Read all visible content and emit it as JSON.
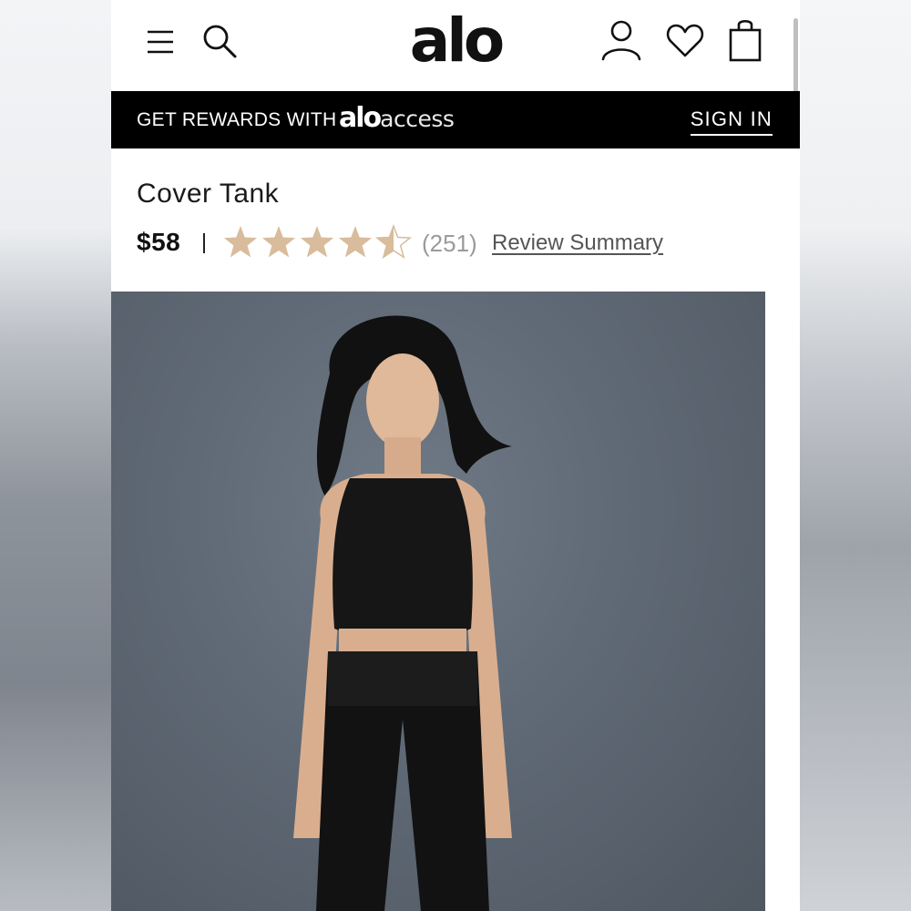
{
  "header": {
    "logo_text": "alo",
    "icons": [
      "menu-icon",
      "search-icon",
      "account-icon",
      "heart-icon",
      "bag-icon"
    ]
  },
  "rewards_bar": {
    "text": "GET REWARDS WITH",
    "brand_alo": "alo",
    "brand_access": "access",
    "sign_in": "SIGN IN"
  },
  "product": {
    "title": "Cover Tank",
    "price": "$58",
    "rating": 4.5,
    "rating_max": 5,
    "review_count": "(251)",
    "review_summary_link": "Review Summary",
    "star_color": "#d8bc9c",
    "image_description_icon": "product-photo"
  },
  "colors": {
    "rewards_bar_bg": "#000000",
    "page_bg": "#ffffff",
    "photo_bg": "#5f6975"
  }
}
